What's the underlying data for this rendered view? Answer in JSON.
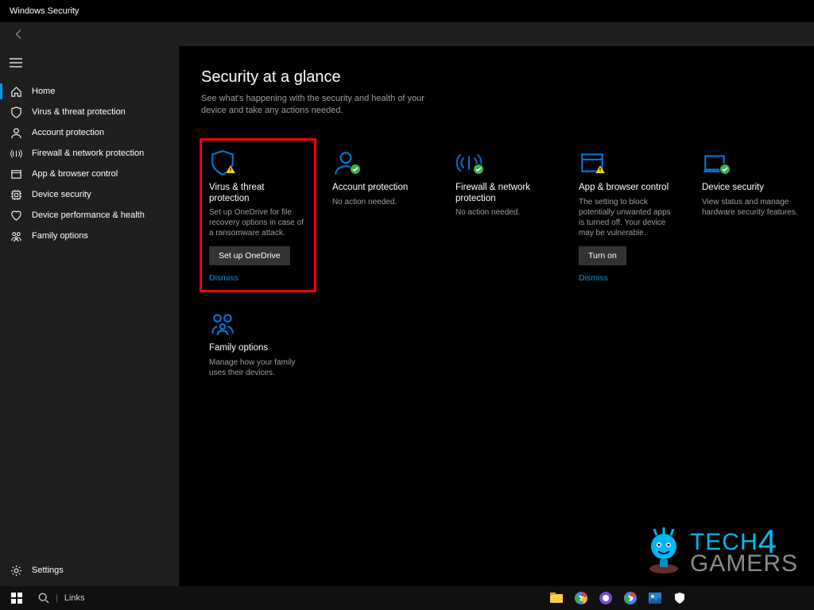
{
  "app_title": "Windows Security",
  "page": {
    "title": "Security at a glance",
    "subtitle": "See what's happening with the security and health of your device and take any actions needed."
  },
  "sidebar": {
    "items": [
      {
        "label": "Home",
        "icon": "home"
      },
      {
        "label": "Virus & threat protection",
        "icon": "shield"
      },
      {
        "label": "Account protection",
        "icon": "person"
      },
      {
        "label": "Firewall & network protection",
        "icon": "firewall"
      },
      {
        "label": "App & browser control",
        "icon": "app"
      },
      {
        "label": "Device security",
        "icon": "device"
      },
      {
        "label": "Device performance & health",
        "icon": "heart"
      },
      {
        "label": "Family options",
        "icon": "family"
      }
    ],
    "settings": "Settings"
  },
  "tiles": [
    {
      "title": "Virus & threat protection",
      "desc": "Set up OneDrive for file recovery options in case of a ransomware attack.",
      "button": "Set up OneDrive",
      "link": "Dismiss",
      "status": "warn",
      "icon": "shield",
      "highlight": true
    },
    {
      "title": "Account protection",
      "desc": "No action needed.",
      "status": "ok",
      "icon": "person"
    },
    {
      "title": "Firewall & network protection",
      "desc": "No action needed.",
      "status": "ok",
      "icon": "firewall"
    },
    {
      "title": "App & browser control",
      "desc": "The setting to block potentially unwanted apps is turned off. Your device may be vulnerable.",
      "button": "Turn on",
      "link": "Dismiss",
      "status": "warn",
      "icon": "app"
    },
    {
      "title": "Device security",
      "desc": "View status and manage hardware security features.",
      "status": "ok",
      "icon": "device"
    },
    {
      "title": "Family options",
      "desc": "Manage how your family uses their devices.",
      "status": "none",
      "icon": "family"
    }
  ],
  "taskbar": {
    "search": "Links"
  },
  "watermark": {
    "line1": "TECH",
    "four": "4",
    "line2": "GAMERS"
  }
}
